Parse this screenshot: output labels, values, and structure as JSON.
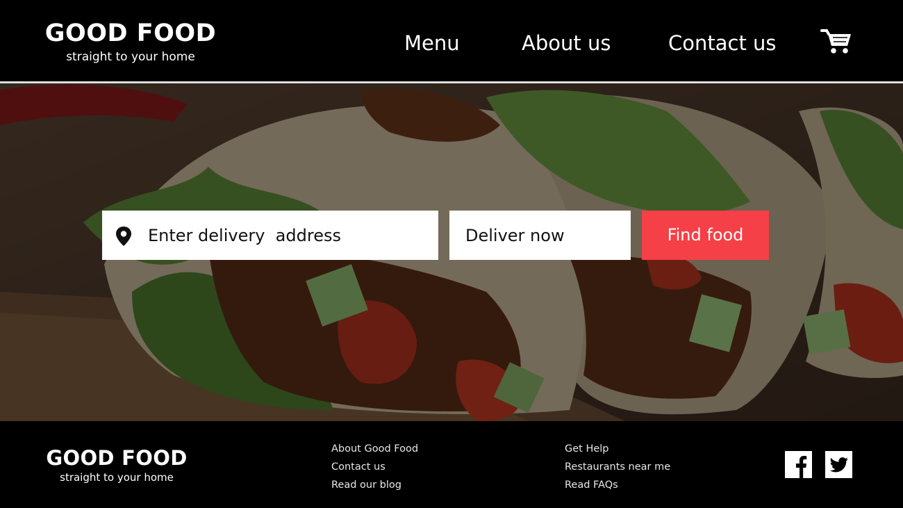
{
  "header": {
    "brand_title": "GOOD FOOD",
    "brand_tagline": "straight to your home",
    "nav": [
      "Menu",
      "About us",
      "Contact us"
    ],
    "cart_icon": "shopping-cart-icon"
  },
  "hero": {
    "address_icon": "location-pin-icon",
    "address_text": "Enter delivery  address",
    "delivery_time": "Deliver now",
    "find_button": "Find food",
    "accent_color": "#f44046"
  },
  "footer": {
    "brand_title": "GOOD FOOD",
    "brand_tagline": "straight to your home",
    "links_col1": [
      "About Good Food",
      "Contact us",
      "Read our blog"
    ],
    "links_col2": [
      "Get Help",
      "Restaurants  near me",
      "Read FAQs"
    ],
    "social": [
      "facebook-icon",
      "twitter-icon"
    ]
  }
}
